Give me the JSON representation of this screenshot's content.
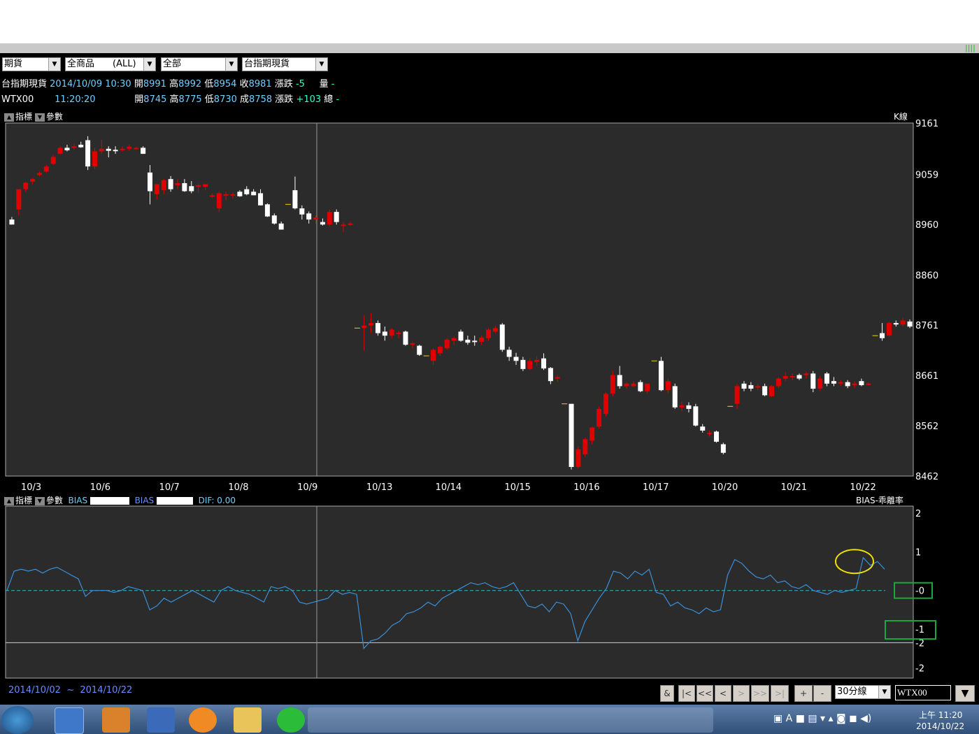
{
  "toolbar": {
    "filters": [
      {
        "label": "期貨"
      },
      {
        "label": "全商品　　(ALL)"
      },
      {
        "label": "全部"
      },
      {
        "label": "台指期現貨"
      }
    ]
  },
  "quotes": [
    {
      "name": "台指期現貨",
      "datetime": "2014/10/09 10:30",
      "open_lbl": "開",
      "open": "8991",
      "high_lbl": "高",
      "high": "8992",
      "low_lbl": "低",
      "low": "8954",
      "close_lbl": "收",
      "close": "8981",
      "chg_lbl": "漲跌",
      "chg": "-5",
      "vol_lbl": "量",
      "vol": "-"
    },
    {
      "name": "WTX00",
      "datetime": "11:20:20",
      "open_lbl": "開",
      "open": "8745",
      "high_lbl": "高",
      "high": "8775",
      "low_lbl": "低",
      "low": "8730",
      "close_lbl": "成",
      "close": "8758",
      "chg_lbl": "漲跌",
      "chg": "+103",
      "vol_lbl": "總",
      "vol": "-"
    }
  ],
  "main_panel": {
    "btn_indicator": "指標",
    "btn_param": "參數",
    "chart_kind": "K線",
    "y_ticks": [
      "9161",
      "9059",
      "8960",
      "8860",
      "8761",
      "8661",
      "8562",
      "8462"
    ],
    "x_ticks": [
      "10/3",
      "10/6",
      "10/7",
      "10/8",
      "10/9",
      "10/13",
      "10/14",
      "10/15",
      "10/16",
      "10/17",
      "10/20",
      "10/21",
      "10/22"
    ]
  },
  "indicator_panel": {
    "btn_indicator": "指標",
    "btn_param": "參數",
    "series1_name": "BIAS",
    "series2_name": "BIAS",
    "dif_label": "DIF:",
    "dif_value": "0.00",
    "title": "BIAS-乖離率",
    "y_ticks": [
      "2",
      "1",
      "-0",
      "-1",
      "-2",
      "-2"
    ]
  },
  "chart_data": {
    "type": "candlestick",
    "unit": "30-minute bars",
    "symbol": "WTX00",
    "ylim": [
      8462,
      9161
    ],
    "candles": [
      {
        "o": 8970,
        "h": 8975,
        "l": 8960,
        "c": 8960,
        "up": false
      },
      {
        "o": 8990,
        "h": 9030,
        "l": 8978,
        "c": 9030,
        "up": true
      },
      {
        "o": 9030,
        "h": 9045,
        "l": 9025,
        "c": 9043,
        "up": true
      },
      {
        "o": 9045,
        "h": 9052,
        "l": 9040,
        "c": 9050,
        "up": true
      },
      {
        "o": 9058,
        "h": 9065,
        "l": 9055,
        "c": 9062,
        "up": true
      },
      {
        "o": 9065,
        "h": 9078,
        "l": 9063,
        "c": 9075,
        "up": true
      },
      {
        "o": 9080,
        "h": 9098,
        "l": 9078,
        "c": 9094,
        "up": true
      },
      {
        "o": 9100,
        "h": 9115,
        "l": 9098,
        "c": 9112,
        "up": true
      },
      {
        "o": 9112,
        "h": 9118,
        "l": 9105,
        "c": 9107,
        "up": false
      },
      {
        "o": 9112,
        "h": 9120,
        "l": 9108,
        "c": 9115,
        "up": true
      },
      {
        "o": 9118,
        "h": 9124,
        "l": 9112,
        "c": 9113,
        "up": false
      },
      {
        "o": 9127,
        "h": 9135,
        "l": 9068,
        "c": 9075,
        "up": false
      },
      {
        "o": 9075,
        "h": 9112,
        "l": 9070,
        "c": 9105,
        "up": true
      },
      {
        "o": 9105,
        "h": 9128,
        "l": 9100,
        "c": 9110,
        "up": true
      },
      {
        "o": 9110,
        "h": 9115,
        "l": 9093,
        "c": 9106,
        "up": false
      },
      {
        "o": 9106,
        "h": 9115,
        "l": 9100,
        "c": 9108,
        "up": false
      },
      {
        "o": 9108,
        "h": 9115,
        "l": 9104,
        "c": 9110,
        "up": true
      },
      {
        "o": 9110,
        "h": 9118,
        "l": 9106,
        "c": 9114,
        "up": true
      },
      {
        "o": 9112,
        "h": 9114,
        "l": 9108,
        "c": 9110,
        "up": true
      },
      {
        "o": 9112,
        "h": 9115,
        "l": 9100,
        "c": 9100,
        "up": false
      },
      {
        "o": 9063,
        "h": 9078,
        "l": 9000,
        "c": 9026,
        "up": false
      },
      {
        "o": 9020,
        "h": 9040,
        "l": 9010,
        "c": 9040,
        "up": true
      },
      {
        "o": 9028,
        "h": 9050,
        "l": 9020,
        "c": 9048,
        "up": true
      },
      {
        "o": 9050,
        "h": 9056,
        "l": 9025,
        "c": 9030,
        "up": false
      },
      {
        "o": 9038,
        "h": 9050,
        "l": 9030,
        "c": 9042,
        "up": true
      },
      {
        "o": 9042,
        "h": 9050,
        "l": 9025,
        "c": 9026,
        "up": false
      },
      {
        "o": 9026,
        "h": 9046,
        "l": 9022,
        "c": 9036,
        "up": false
      },
      {
        "o": 9035,
        "h": 9040,
        "l": 9022,
        "c": 9038,
        "up": true
      },
      {
        "o": 9035,
        "h": 9040,
        "l": 9028,
        "c": 9040,
        "up": true
      },
      {
        "o": 9018,
        "h": 9022,
        "l": 9012,
        "c": 9018,
        "up": true
      },
      {
        "o": 8992,
        "h": 9025,
        "l": 8985,
        "c": 9022,
        "up": true
      },
      {
        "o": 9020,
        "h": 9025,
        "l": 9008,
        "c": 9020,
        "up": true
      },
      {
        "o": 9020,
        "h": 9024,
        "l": 9012,
        "c": 9018,
        "up": true
      },
      {
        "o": 9025,
        "h": 9028,
        "l": 9015,
        "c": 9016,
        "up": false
      },
      {
        "o": 9030,
        "h": 9036,
        "l": 9018,
        "c": 9020,
        "up": false
      },
      {
        "o": 9025,
        "h": 9030,
        "l": 9018,
        "c": 9018,
        "up": false
      },
      {
        "o": 9022,
        "h": 9030,
        "l": 8998,
        "c": 8998,
        "up": false
      },
      {
        "o": 9000,
        "h": 9002,
        "l": 8975,
        "c": 8976,
        "up": false
      },
      {
        "o": 8978,
        "h": 8982,
        "l": 8960,
        "c": 8962,
        "up": false
      },
      {
        "o": 8962,
        "h": 8966,
        "l": 8950,
        "c": 8950,
        "up": false
      },
      {
        "o": 9000,
        "h": 9000,
        "l": 9000,
        "c": 9000,
        "up": true
      },
      {
        "o": 9028,
        "h": 9055,
        "l": 8990,
        "c": 8992,
        "up": false
      },
      {
        "o": 8992,
        "h": 8998,
        "l": 8970,
        "c": 8980,
        "up": false
      },
      {
        "o": 8982,
        "h": 8986,
        "l": 8962,
        "c": 8970,
        "up": false
      },
      {
        "o": 8970,
        "h": 8978,
        "l": 8962,
        "c": 8974,
        "up": true
      },
      {
        "o": 8965,
        "h": 8972,
        "l": 8958,
        "c": 8960,
        "up": false
      },
      {
        "o": 8960,
        "h": 8990,
        "l": 8956,
        "c": 8985,
        "up": true
      },
      {
        "o": 8985,
        "h": 8990,
        "l": 8960,
        "c": 8965,
        "up": false
      },
      {
        "o": 8958,
        "h": 8965,
        "l": 8945,
        "c": 8960,
        "up": true
      },
      {
        "o": 8962,
        "h": 8965,
        "l": 8958,
        "c": 8962,
        "up": true
      },
      {
        "o": 8755,
        "h": 8755,
        "l": 8755,
        "c": 8755,
        "up": false
      },
      {
        "o": 8755,
        "h": 8780,
        "l": 8710,
        "c": 8760,
        "up": true
      },
      {
        "o": 8760,
        "h": 8785,
        "l": 8745,
        "c": 8765,
        "up": true
      },
      {
        "o": 8765,
        "h": 8770,
        "l": 8740,
        "c": 8745,
        "up": false
      },
      {
        "o": 8748,
        "h": 8758,
        "l": 8730,
        "c": 8740,
        "up": false
      },
      {
        "o": 8740,
        "h": 8755,
        "l": 8735,
        "c": 8752,
        "up": true
      },
      {
        "o": 8745,
        "h": 8750,
        "l": 8735,
        "c": 8746,
        "up": true
      },
      {
        "o": 8748,
        "h": 8750,
        "l": 8720,
        "c": 8722,
        "up": false
      },
      {
        "o": 8722,
        "h": 8728,
        "l": 8715,
        "c": 8725,
        "up": true
      },
      {
        "o": 8720,
        "h": 8722,
        "l": 8700,
        "c": 8702,
        "up": false
      },
      {
        "o": 8700,
        "h": 8700,
        "l": 8700,
        "c": 8700,
        "up": false
      },
      {
        "o": 8690,
        "h": 8715,
        "l": 8682,
        "c": 8712,
        "up": true
      },
      {
        "o": 8705,
        "h": 8720,
        "l": 8700,
        "c": 8718,
        "up": true
      },
      {
        "o": 8715,
        "h": 8735,
        "l": 8712,
        "c": 8732,
        "up": true
      },
      {
        "o": 8730,
        "h": 8738,
        "l": 8722,
        "c": 8735,
        "up": true
      },
      {
        "o": 8748,
        "h": 8752,
        "l": 8728,
        "c": 8730,
        "up": false
      },
      {
        "o": 8732,
        "h": 8740,
        "l": 8722,
        "c": 8726,
        "up": false
      },
      {
        "o": 8730,
        "h": 8740,
        "l": 8720,
        "c": 8728,
        "up": false
      },
      {
        "o": 8728,
        "h": 8740,
        "l": 8722,
        "c": 8736,
        "up": true
      },
      {
        "o": 8735,
        "h": 8755,
        "l": 8730,
        "c": 8752,
        "up": true
      },
      {
        "o": 8755,
        "h": 8760,
        "l": 8745,
        "c": 8748,
        "up": true
      },
      {
        "o": 8762,
        "h": 8765,
        "l": 8708,
        "c": 8712,
        "up": false
      },
      {
        "o": 8712,
        "h": 8718,
        "l": 8690,
        "c": 8698,
        "up": false
      },
      {
        "o": 8698,
        "h": 8706,
        "l": 8682,
        "c": 8690,
        "up": false
      },
      {
        "o": 8692,
        "h": 8698,
        "l": 8670,
        "c": 8674,
        "up": false
      },
      {
        "o": 8674,
        "h": 8695,
        "l": 8672,
        "c": 8690,
        "up": true
      },
      {
        "o": 8688,
        "h": 8700,
        "l": 8680,
        "c": 8692,
        "up": true
      },
      {
        "o": 8695,
        "h": 8705,
        "l": 8672,
        "c": 8675,
        "up": false
      },
      {
        "o": 8676,
        "h": 8678,
        "l": 8644,
        "c": 8650,
        "up": false
      },
      {
        "o": 8658,
        "h": 8662,
        "l": 8648,
        "c": 8655,
        "up": true
      },
      {
        "o": 8605,
        "h": 8605,
        "l": 8605,
        "c": 8605,
        "up": false
      },
      {
        "o": 8605,
        "h": 8605,
        "l": 8475,
        "c": 8480,
        "up": false
      },
      {
        "o": 8480,
        "h": 8520,
        "l": 8478,
        "c": 8515,
        "up": true
      },
      {
        "o": 8505,
        "h": 8538,
        "l": 8500,
        "c": 8535,
        "up": true
      },
      {
        "o": 8532,
        "h": 8560,
        "l": 8525,
        "c": 8558,
        "up": true
      },
      {
        "o": 8560,
        "h": 8600,
        "l": 8556,
        "c": 8595,
        "up": true
      },
      {
        "o": 8585,
        "h": 8628,
        "l": 8580,
        "c": 8625,
        "up": true
      },
      {
        "o": 8625,
        "h": 8670,
        "l": 8620,
        "c": 8662,
        "up": true
      },
      {
        "o": 8662,
        "h": 8680,
        "l": 8635,
        "c": 8640,
        "up": false
      },
      {
        "o": 8640,
        "h": 8648,
        "l": 8635,
        "c": 8645,
        "up": true
      },
      {
        "o": 8645,
        "h": 8650,
        "l": 8638,
        "c": 8640,
        "up": true
      },
      {
        "o": 8648,
        "h": 8652,
        "l": 8628,
        "c": 8630,
        "up": false
      },
      {
        "o": 8630,
        "h": 8645,
        "l": 8625,
        "c": 8645,
        "up": true
      },
      {
        "o": 8690,
        "h": 8690,
        "l": 8690,
        "c": 8690,
        "up": false
      },
      {
        "o": 8690,
        "h": 8698,
        "l": 8630,
        "c": 8632,
        "up": false
      },
      {
        "o": 8632,
        "h": 8655,
        "l": 8625,
        "c": 8650,
        "up": true
      },
      {
        "o": 8640,
        "h": 8645,
        "l": 8595,
        "c": 8598,
        "up": false
      },
      {
        "o": 8598,
        "h": 8610,
        "l": 8590,
        "c": 8602,
        "up": true
      },
      {
        "o": 8602,
        "h": 8608,
        "l": 8588,
        "c": 8595,
        "up": false
      },
      {
        "o": 8600,
        "h": 8605,
        "l": 8560,
        "c": 8562,
        "up": false
      },
      {
        "o": 8560,
        "h": 8565,
        "l": 8548,
        "c": 8552,
        "up": false
      },
      {
        "o": 8548,
        "h": 8552,
        "l": 8540,
        "c": 8545,
        "up": true
      },
      {
        "o": 8550,
        "h": 8552,
        "l": 8528,
        "c": 8530,
        "up": false
      },
      {
        "o": 8525,
        "h": 8528,
        "l": 8505,
        "c": 8508,
        "up": false
      },
      {
        "o": 8600,
        "h": 8600,
        "l": 8600,
        "c": 8600,
        "up": false
      },
      {
        "o": 8605,
        "h": 8645,
        "l": 8595,
        "c": 8640,
        "up": true
      },
      {
        "o": 8635,
        "h": 8650,
        "l": 8630,
        "c": 8645,
        "up": false
      },
      {
        "o": 8642,
        "h": 8648,
        "l": 8630,
        "c": 8635,
        "up": false
      },
      {
        "o": 8638,
        "h": 8645,
        "l": 8632,
        "c": 8640,
        "up": true
      },
      {
        "o": 8640,
        "h": 8645,
        "l": 8620,
        "c": 8622,
        "up": false
      },
      {
        "o": 8620,
        "h": 8642,
        "l": 8618,
        "c": 8640,
        "up": true
      },
      {
        "o": 8640,
        "h": 8658,
        "l": 8636,
        "c": 8655,
        "up": true
      },
      {
        "o": 8655,
        "h": 8668,
        "l": 8650,
        "c": 8660,
        "up": true
      },
      {
        "o": 8660,
        "h": 8665,
        "l": 8652,
        "c": 8658,
        "up": true
      },
      {
        "o": 8662,
        "h": 8665,
        "l": 8652,
        "c": 8655,
        "up": false
      },
      {
        "o": 8665,
        "h": 8668,
        "l": 8655,
        "c": 8662,
        "up": true
      },
      {
        "o": 8665,
        "h": 8670,
        "l": 8628,
        "c": 8635,
        "up": false
      },
      {
        "o": 8635,
        "h": 8660,
        "l": 8630,
        "c": 8655,
        "up": true
      },
      {
        "o": 8665,
        "h": 8668,
        "l": 8640,
        "c": 8645,
        "up": false
      },
      {
        "o": 8650,
        "h": 8658,
        "l": 8640,
        "c": 8645,
        "up": false
      },
      {
        "o": 8645,
        "h": 8652,
        "l": 8640,
        "c": 8648,
        "up": true
      },
      {
        "o": 8648,
        "h": 8652,
        "l": 8636,
        "c": 8640,
        "up": false
      },
      {
        "o": 8642,
        "h": 8650,
        "l": 8636,
        "c": 8645,
        "up": true
      },
      {
        "o": 8650,
        "h": 8655,
        "l": 8640,
        "c": 8642,
        "up": false
      },
      {
        "o": 8645,
        "h": 8648,
        "l": 8642,
        "c": 8645,
        "up": true
      },
      {
        "o": 8740,
        "h": 8740,
        "l": 8740,
        "c": 8740,
        "up": false
      },
      {
        "o": 8745,
        "h": 8765,
        "l": 8730,
        "c": 8735,
        "up": false
      },
      {
        "o": 8740,
        "h": 8768,
        "l": 8738,
        "c": 8765,
        "up": true
      },
      {
        "o": 8765,
        "h": 8770,
        "l": 8758,
        "c": 8762,
        "up": false
      },
      {
        "o": 8762,
        "h": 8775,
        "l": 8758,
        "c": 8770,
        "up": true
      },
      {
        "o": 8768,
        "h": 8772,
        "l": 8755,
        "c": 8758,
        "up": false
      }
    ],
    "bias": [
      0.0,
      0.5,
      0.55,
      0.5,
      0.55,
      0.45,
      0.55,
      0.6,
      0.5,
      0.4,
      0.3,
      -0.15,
      0.0,
      0.0,
      0.0,
      -0.05,
      0.0,
      0.1,
      0.05,
      0.0,
      -0.5,
      -0.4,
      -0.2,
      -0.3,
      -0.2,
      -0.1,
      0.0,
      -0.1,
      -0.2,
      -0.3,
      0.0,
      0.1,
      0.0,
      -0.05,
      -0.1,
      -0.2,
      -0.3,
      0.1,
      0.05,
      0.1,
      0.0,
      -0.3,
      -0.35,
      -0.3,
      -0.25,
      -0.2,
      0.0,
      -0.1,
      -0.05,
      -0.1,
      -1.5,
      -1.3,
      -1.25,
      -1.1,
      -0.9,
      -0.8,
      -0.6,
      -0.55,
      -0.45,
      -0.3,
      -0.4,
      -0.2,
      -0.1,
      0.0,
      0.1,
      0.2,
      0.15,
      0.2,
      0.1,
      0.05,
      0.1,
      0.2,
      -0.1,
      -0.4,
      -0.45,
      -0.35,
      -0.55,
      -0.3,
      -0.35,
      -0.6,
      -1.3,
      -0.8,
      -0.5,
      -0.2,
      0.05,
      0.5,
      0.45,
      0.3,
      0.5,
      0.4,
      0.55,
      -0.05,
      -0.1,
      -0.4,
      -0.3,
      -0.45,
      -0.5,
      -0.6,
      -0.45,
      -0.55,
      -0.5,
      0.4,
      0.8,
      0.7,
      0.5,
      0.35,
      0.3,
      0.4,
      0.2,
      0.25,
      0.1,
      0.05,
      0.15,
      0.0,
      -0.05,
      -0.1,
      0.0,
      -0.05,
      0.0,
      0.05,
      0.85,
      0.65,
      0.75,
      0.55
    ],
    "bias_zero_line": 0
  },
  "range": {
    "start": "2014/10/02",
    "sep": "~",
    "end": "2014/10/22"
  },
  "nav": {
    "buttons": [
      "&",
      "|<",
      "<<",
      "<",
      ">",
      ">>",
      ">|",
      "+",
      "-"
    ],
    "period": "30分線",
    "symbol": "WTX00"
  },
  "taskbar": {
    "clock_time": "上午 11:20",
    "clock_date": "2014/10/22"
  },
  "colors": {
    "up": "#e00000",
    "down": "#ffffff",
    "bias_line": "#3a8fd8",
    "zero_line": "#3ab0c8",
    "highlight_circle": "#f0e000",
    "highlight_box": "#1aa83a"
  }
}
